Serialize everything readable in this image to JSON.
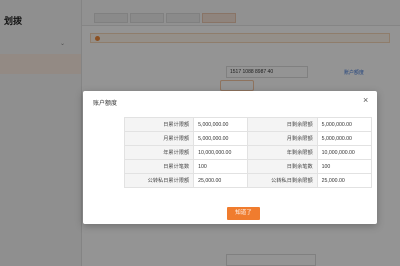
{
  "modal": {
    "title": "账户额度",
    "ok_label": "知道了",
    "limits": [
      {
        "left_label": "日累计限额",
        "left_value": "5,000,000.00",
        "right_label": "日剩余限额",
        "right_value": "5,000,000.00"
      },
      {
        "left_label": "月累计限额",
        "left_value": "5,000,000.00",
        "right_label": "月剩余限额",
        "right_value": "5,000,000.00"
      },
      {
        "left_label": "年累计限额",
        "left_value": "10,000,000.00",
        "right_label": "年剩余限额",
        "right_value": "10,000,000.00"
      },
      {
        "left_label": "日累计笔数",
        "left_value": "100",
        "right_label": "日剩余笔数",
        "right_value": "100"
      },
      {
        "left_label": "公转私日累计限额",
        "left_value": "25,000.00",
        "right_label": "公转私日剩余限额",
        "right_value": "25,000.00"
      }
    ]
  },
  "background": {
    "brand": "划拨",
    "account_number": "1517 1088 8987 40",
    "quota_link": "账户额度"
  },
  "colors": {
    "accent": "#f07c2e",
    "overlay": "rgba(0,0,0,0.42)"
  }
}
